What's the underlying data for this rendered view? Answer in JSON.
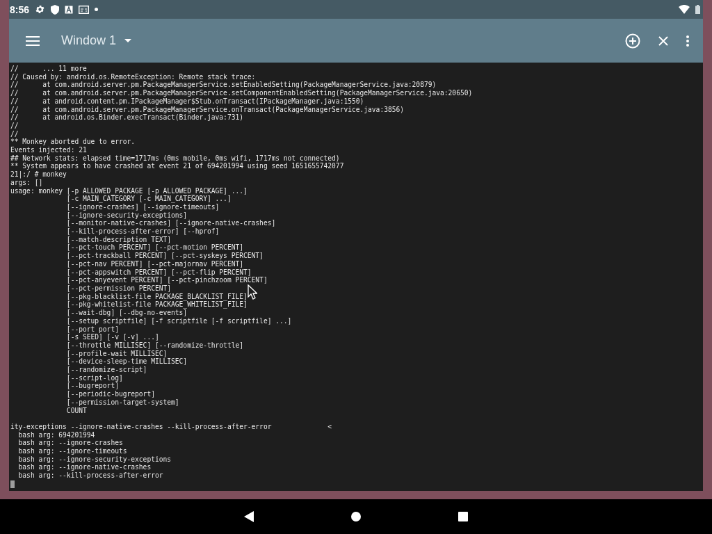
{
  "status_bar": {
    "time": "8:56"
  },
  "toolbar": {
    "title": "Window 1"
  },
  "terminal": {
    "lines": [
      "//      ... 11 more",
      "// Caused by: android.os.RemoteException: Remote stack trace:",
      "//      at com.android.server.pm.PackageManagerService.setEnabledSetting(PackageManagerService.java:20879)",
      "//      at com.android.server.pm.PackageManagerService.setComponentEnabledSetting(PackageManagerService.java:20650)",
      "//      at android.content.pm.IPackageManager$Stub.onTransact(IPackageManager.java:1550)",
      "//      at com.android.server.pm.PackageManagerService.onTransact(PackageManagerService.java:3856)",
      "//      at android.os.Binder.execTransact(Binder.java:731)",
      "//",
      "//",
      "** Monkey aborted due to error.",
      "Events injected: 21",
      "## Network stats: elapsed time=1717ms (0ms mobile, 0ms wifi, 1717ms not connected)",
      "** System appears to have crashed at event 21 of 694201994 using seed 1651655742077",
      "21|:/ # monkey",
      "args: []",
      "usage: monkey [-p ALLOWED_PACKAGE [-p ALLOWED_PACKAGE] ...]",
      "              [-c MAIN_CATEGORY [-c MAIN_CATEGORY] ...]",
      "              [--ignore-crashes] [--ignore-timeouts]",
      "              [--ignore-security-exceptions]",
      "              [--monitor-native-crashes] [--ignore-native-crashes]",
      "              [--kill-process-after-error] [--hprof]",
      "              [--match-description TEXT]",
      "              [--pct-touch PERCENT] [--pct-motion PERCENT]",
      "              [--pct-trackball PERCENT] [--pct-syskeys PERCENT]",
      "              [--pct-nav PERCENT] [--pct-majornav PERCENT]",
      "              [--pct-appswitch PERCENT] [--pct-flip PERCENT]",
      "              [--pct-anyevent PERCENT] [--pct-pinchzoom PERCENT]",
      "              [--pct-permission PERCENT]",
      "              [--pkg-blacklist-file PACKAGE_BLACKLIST_FILE]",
      "              [--pkg-whitelist-file PACKAGE_WHITELIST_FILE]",
      "              [--wait-dbg] [--dbg-no-events]",
      "              [--setup scriptfile] [-f scriptfile [-f scriptfile] ...]",
      "              [--port port]",
      "              [-s SEED] [-v [-v] ...]",
      "              [--throttle MILLISEC] [--randomize-throttle]",
      "              [--profile-wait MILLISEC]",
      "              [--device-sleep-time MILLISEC]",
      "              [--randomize-script]",
      "              [--script-log]",
      "              [--bugreport]",
      "              [--periodic-bugreport]",
      "              [--permission-target-system]",
      "              COUNT"
    ],
    "tail": [
      "ity-exceptions --ignore-native-crashes --kill-process-after-error              <",
      "  bash arg: 694201994",
      "  bash arg: --ignore-crashes",
      "  bash arg: --ignore-timeouts",
      "  bash arg: --ignore-security-exceptions",
      "  bash arg: --ignore-native-crashes",
      "  bash arg: --kill-process-after-error"
    ]
  }
}
